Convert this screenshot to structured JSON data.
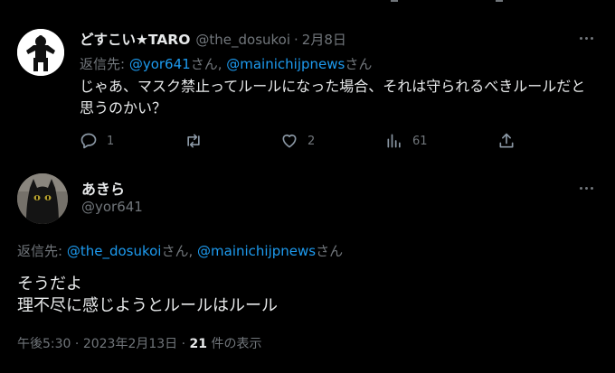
{
  "tweet_reply": {
    "author": {
      "display_name": "どすこい★TARO",
      "handle": "@the_dosukoi"
    },
    "date": "2月8日",
    "separator": "·",
    "reply_prefix": "返信先: ",
    "reply_mentions": [
      "@yor641",
      "@mainichijpnews"
    ],
    "mention_suffix": "さん",
    "mention_joiner": ", ",
    "body": "じゃあ、マスク禁止ってルールになった場合、それは守られるべきルールだと思うのかい？",
    "stats": {
      "replies": "1",
      "likes": "2",
      "views": "61"
    }
  },
  "tweet_main": {
    "author": {
      "display_name": "あきら",
      "handle": "@yor641"
    },
    "reply_prefix": "返信先: ",
    "reply_mentions": [
      "@the_dosukoi",
      "@mainichijpnews"
    ],
    "mention_suffix": "さん",
    "mention_joiner": ", ",
    "body_lines": [
      "そうだよ",
      "理不尽に感じようとルールはルール"
    ],
    "time": "午後5:30",
    "separator": "·",
    "date": "2023年2月13日",
    "views_count": "21",
    "views_label": "件の表示"
  },
  "icons": {
    "reply": "reply-icon",
    "retweet": "retweet-icon",
    "like": "heart-icon",
    "views": "analytics-icon",
    "share": "share-icon",
    "more": "more-icon"
  },
  "colors": {
    "background": "#000000",
    "text": "#e7e9ea",
    "muted": "#71767b",
    "link": "#1d9bf0"
  }
}
